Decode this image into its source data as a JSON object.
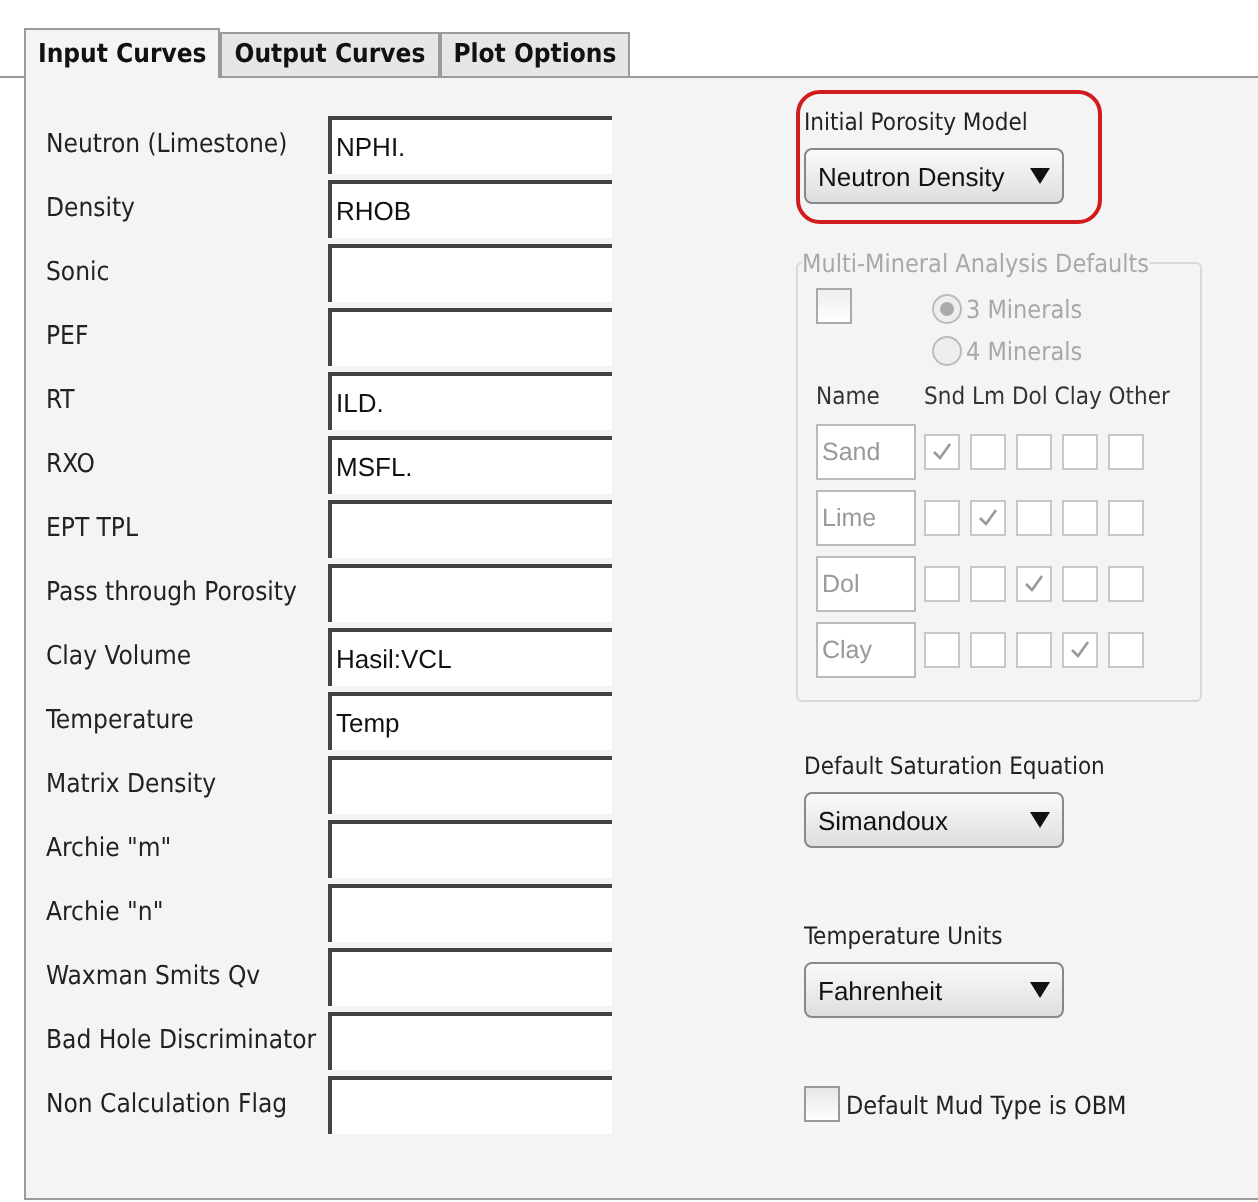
{
  "tabs": [
    {
      "label": "Input Curves",
      "selected": true
    },
    {
      "label": "Output Curves",
      "selected": false
    },
    {
      "label": "Plot Options",
      "selected": false
    }
  ],
  "input_curves": [
    {
      "label": "Neutron (Limestone)",
      "value": "NPHI."
    },
    {
      "label": "Density",
      "value": "RHOB"
    },
    {
      "label": "Sonic"
    },
    {
      "label": "PEF"
    },
    {
      "label": "RT",
      "value": "ILD."
    },
    {
      "label": "RXO",
      "value": "MSFL."
    },
    {
      "label": "EPT TPL"
    },
    {
      "label": "Pass through Porosity"
    },
    {
      "label": "Clay Volume",
      "value": "Hasil:VCL"
    },
    {
      "label": "Temperature",
      "value": "Temp"
    },
    {
      "label": "Matrix Density"
    },
    {
      "label": "Archie \"m\""
    },
    {
      "label": "Archie \"n\""
    },
    {
      "label": "Waxman Smits Qv"
    },
    {
      "label": "Bad Hole Discriminator"
    },
    {
      "label": "Non Calculation Flag"
    }
  ],
  "porosity_model": {
    "label": "Initial Porosity Model",
    "value": "Neutron Density",
    "highlighted": true
  },
  "multi_mineral": {
    "title": "Multi-Mineral Analysis Defaults",
    "checked": false,
    "disabled": true,
    "options": [
      {
        "label": "3 Minerals",
        "selected": true
      },
      {
        "label": "4 Minerals",
        "selected": false
      }
    ],
    "columns": [
      "Name",
      "Snd",
      "Lm",
      "Dol",
      "Clay",
      "Other"
    ],
    "rows": [
      {
        "name": "Sand",
        "checks": [
          true,
          false,
          false,
          false,
          false
        ]
      },
      {
        "name": "Lime",
        "checks": [
          false,
          true,
          false,
          false,
          false
        ]
      },
      {
        "name": "Dol",
        "checks": [
          false,
          false,
          true,
          false,
          false
        ]
      },
      {
        "name": "Clay",
        "checks": [
          false,
          false,
          false,
          true,
          false
        ]
      }
    ]
  },
  "saturation_equation": {
    "label": "Default Saturation Equation",
    "value": "Simandoux"
  },
  "temperature_units": {
    "label": "Temperature Units",
    "value": "Fahrenheit"
  },
  "mud_type": {
    "label": "Default Mud Type is OBM",
    "checked": false
  }
}
